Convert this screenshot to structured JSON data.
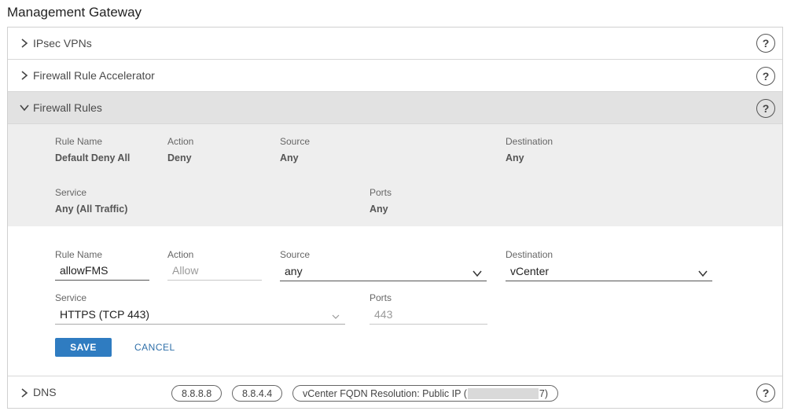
{
  "page": {
    "title": "Management Gateway"
  },
  "accordion": {
    "ipsec": {
      "label": "IPsec VPNs",
      "help": "?"
    },
    "accelerator": {
      "label": "Firewall Rule Accelerator",
      "help": "?"
    },
    "firewall": {
      "label": "Firewall Rules",
      "help": "?"
    },
    "dns": {
      "label": "DNS",
      "help": "?"
    }
  },
  "existing_rule": {
    "rule_name_label": "Rule Name",
    "rule_name": "Default Deny All",
    "action_label": "Action",
    "action": "Deny",
    "source_label": "Source",
    "source": "Any",
    "destination_label": "Destination",
    "destination": "Any",
    "service_label": "Service",
    "service": "Any (All Traffic)",
    "ports_label": "Ports",
    "ports": "Any"
  },
  "new_rule": {
    "rule_name_label": "Rule Name",
    "rule_name_value": "allowFMS",
    "action_label": "Action",
    "action_value": "Allow",
    "source_label": "Source",
    "source_value": "any",
    "destination_label": "Destination",
    "destination_value": "vCenter",
    "service_label": "Service",
    "service_value": "HTTPS (TCP 443)",
    "ports_label": "Ports",
    "ports_value": "443",
    "save_label": "SAVE",
    "cancel_label": "CANCEL"
  },
  "dns": {
    "servers": [
      "8.8.8.8",
      "8.8.4.4"
    ],
    "resolution_prefix": "vCenter FQDN Resolution: Public IP (",
    "resolution_suffix": "7)"
  }
}
